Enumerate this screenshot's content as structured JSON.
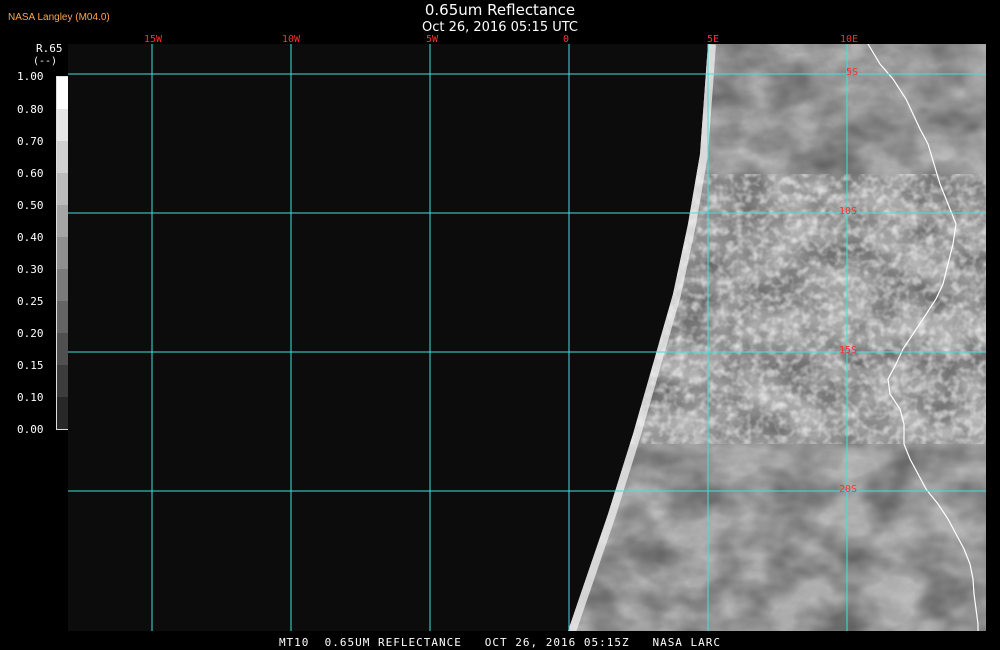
{
  "header": {
    "producer": "NASA Langley (M04.0)",
    "title": "0.65um Reflectance",
    "subtitle": "Oct 26, 2016 05:15 UTC"
  },
  "legend": {
    "parameter": "R.65",
    "unit": "(--)",
    "ticks": [
      "1.00",
      "0.80",
      "0.70",
      "0.60",
      "0.50",
      "0.40",
      "0.30",
      "0.25",
      "0.20",
      "0.15",
      "0.10",
      "0.00"
    ]
  },
  "map": {
    "longitude_labels": [
      "15W",
      "10W",
      "5W",
      "0",
      "5E",
      "10E"
    ],
    "latitude_labels": [
      "5S",
      "10S",
      "15S",
      "20S"
    ],
    "colors": {
      "grid": "#40e0e0",
      "labels": "#ff2f2f",
      "coastline": "#ffffff",
      "background": "#0c0c0c"
    }
  },
  "footer": {
    "text": "MT10  0.65UM REFLECTANCE   OCT 26, 2016 05:15Z   NASA LARC"
  }
}
